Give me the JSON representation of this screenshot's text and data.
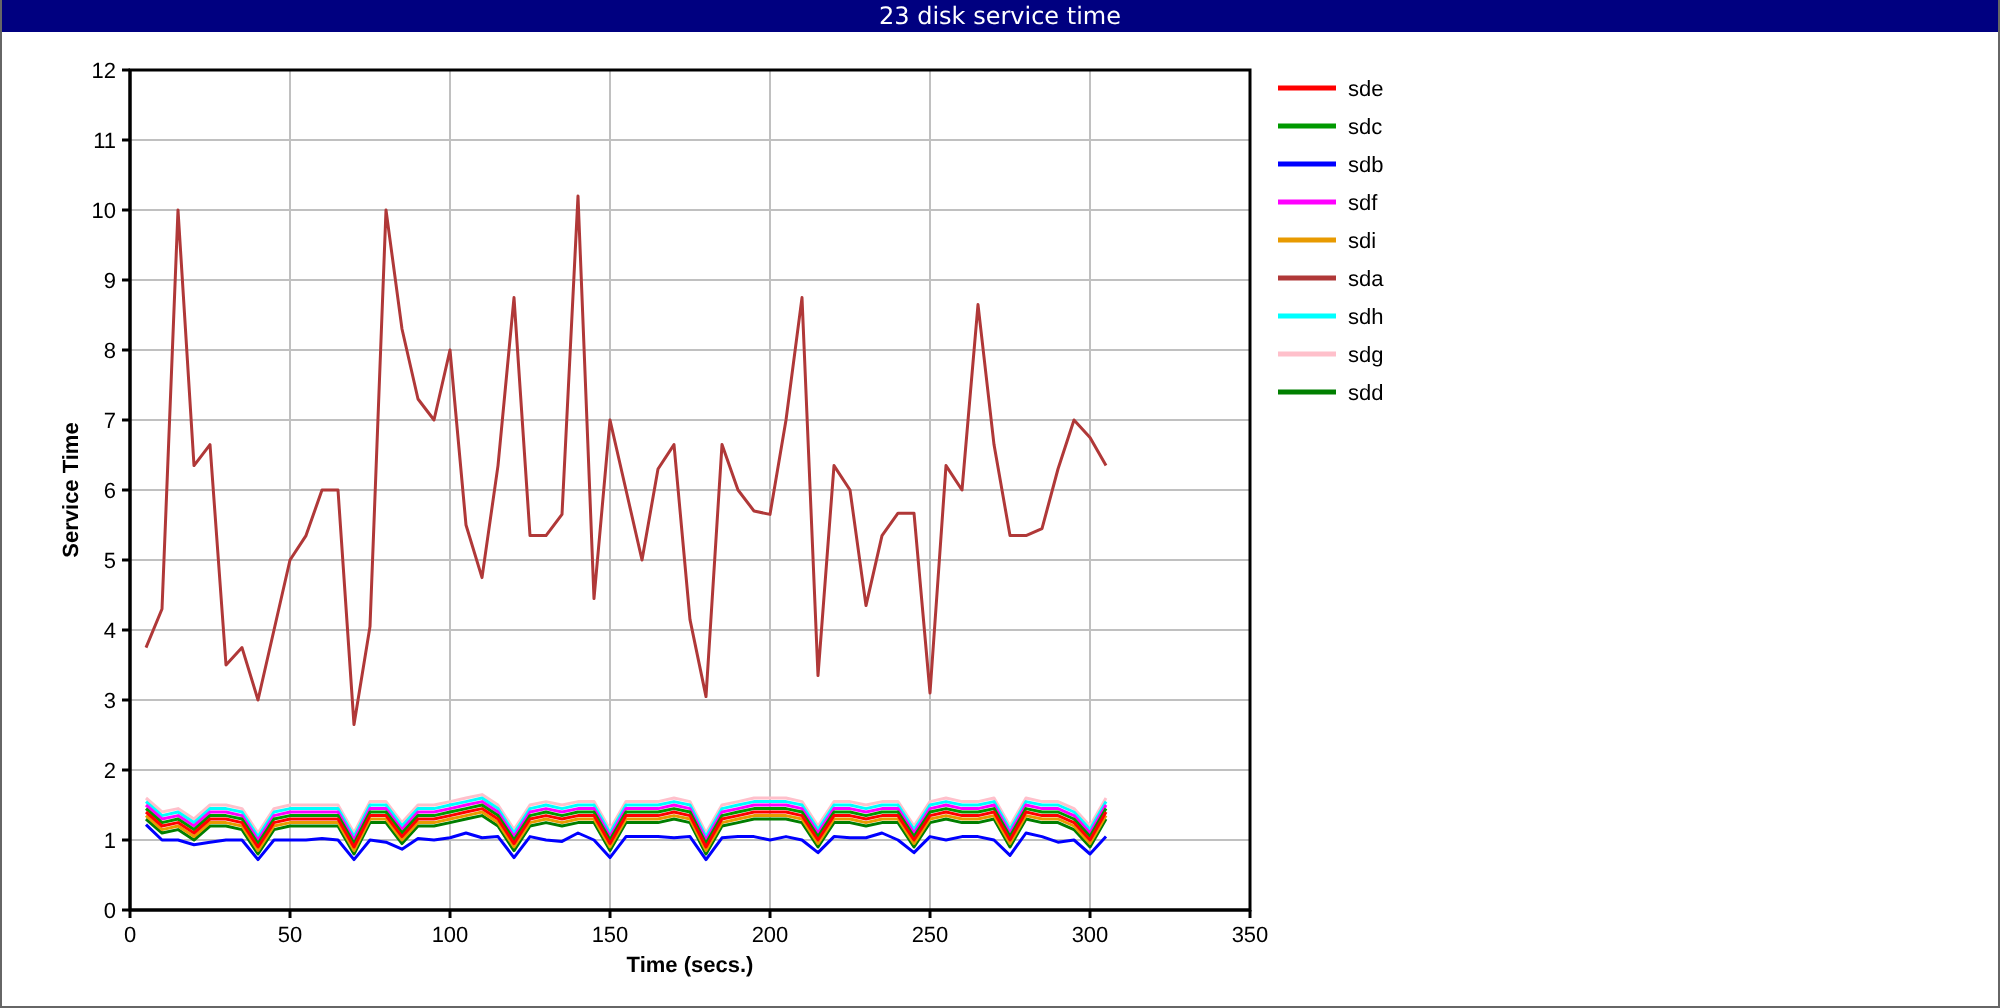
{
  "window": {
    "title": "23 disk service time"
  },
  "chart": {
    "chart_data": {
      "type": "line",
      "xlabel": "Time (secs.)",
      "ylabel": "Service Time",
      "x": [
        5,
        10,
        15,
        20,
        25,
        30,
        35,
        40,
        45,
        50,
        55,
        60,
        65,
        70,
        75,
        80,
        85,
        90,
        95,
        100,
        105,
        110,
        115,
        120,
        125,
        130,
        135,
        140,
        145,
        150,
        155,
        160,
        165,
        170,
        175,
        180,
        185,
        190,
        195,
        200,
        205,
        210,
        215,
        220,
        225,
        230,
        235,
        240,
        245,
        250,
        255,
        260,
        265,
        270,
        275,
        280,
        285,
        290,
        295,
        300,
        305
      ],
      "xlim": [
        0,
        350
      ],
      "ylim": [
        0,
        12
      ],
      "xticks": [
        0,
        50,
        100,
        150,
        200,
        250,
        300,
        350
      ],
      "yticks": [
        0,
        1,
        2,
        3,
        4,
        5,
        6,
        7,
        8,
        9,
        10,
        11,
        12
      ],
      "grid": true,
      "legend": "right",
      "series": [
        {
          "name": "sde",
          "color": "#ff0000",
          "values": [
            1.4,
            1.2,
            1.25,
            1.1,
            1.3,
            1.3,
            1.25,
            0.9,
            1.25,
            1.3,
            1.3,
            1.3,
            1.3,
            0.9,
            1.35,
            1.35,
            1.05,
            1.3,
            1.3,
            1.35,
            1.4,
            1.45,
            1.3,
            0.95,
            1.3,
            1.35,
            1.3,
            1.35,
            1.35,
            0.95,
            1.35,
            1.35,
            1.35,
            1.4,
            1.35,
            0.9,
            1.3,
            1.35,
            1.4,
            1.4,
            1.4,
            1.35,
            1.0,
            1.35,
            1.35,
            1.3,
            1.35,
            1.35,
            1.0,
            1.35,
            1.4,
            1.35,
            1.35,
            1.4,
            1.0,
            1.4,
            1.35,
            1.35,
            1.25,
            1.0,
            1.4
          ]
        },
        {
          "name": "sdc",
          "color": "#009900",
          "values": [
            1.45,
            1.25,
            1.3,
            1.15,
            1.35,
            1.35,
            1.3,
            0.95,
            1.3,
            1.35,
            1.35,
            1.35,
            1.35,
            0.95,
            1.4,
            1.4,
            1.1,
            1.35,
            1.35,
            1.4,
            1.45,
            1.5,
            1.35,
            1.0,
            1.35,
            1.4,
            1.35,
            1.4,
            1.4,
            1.0,
            1.4,
            1.4,
            1.4,
            1.45,
            1.4,
            0.95,
            1.35,
            1.4,
            1.45,
            1.45,
            1.45,
            1.4,
            1.05,
            1.4,
            1.4,
            1.35,
            1.4,
            1.4,
            1.05,
            1.4,
            1.45,
            1.4,
            1.4,
            1.45,
            1.05,
            1.45,
            1.4,
            1.4,
            1.3,
            1.05,
            1.45
          ]
        },
        {
          "name": "sdb",
          "color": "#0000ff",
          "values": [
            1.22,
            1.0,
            1.0,
            0.93,
            0.97,
            1.0,
            1.0,
            0.72,
            1.0,
            1.0,
            1.0,
            1.02,
            1.0,
            0.72,
            1.0,
            0.97,
            0.87,
            1.02,
            1.0,
            1.03,
            1.1,
            1.03,
            1.05,
            0.75,
            1.05,
            1.0,
            0.98,
            1.1,
            1.0,
            0.75,
            1.05,
            1.05,
            1.05,
            1.03,
            1.05,
            0.72,
            1.03,
            1.05,
            1.05,
            1.0,
            1.05,
            1.0,
            0.82,
            1.05,
            1.03,
            1.03,
            1.1,
            1.0,
            0.82,
            1.05,
            1.0,
            1.05,
            1.05,
            1.0,
            0.78,
            1.1,
            1.05,
            0.97,
            1.0,
            0.8,
            1.05
          ]
        },
        {
          "name": "sdf",
          "color": "#ff00ff",
          "values": [
            1.5,
            1.3,
            1.35,
            1.2,
            1.4,
            1.4,
            1.35,
            1.0,
            1.35,
            1.4,
            1.4,
            1.4,
            1.4,
            1.0,
            1.45,
            1.45,
            1.15,
            1.4,
            1.4,
            1.45,
            1.5,
            1.55,
            1.4,
            1.05,
            1.4,
            1.45,
            1.4,
            1.45,
            1.45,
            1.05,
            1.45,
            1.45,
            1.45,
            1.5,
            1.45,
            1.0,
            1.4,
            1.45,
            1.5,
            1.5,
            1.5,
            1.45,
            1.1,
            1.45,
            1.45,
            1.4,
            1.45,
            1.45,
            1.1,
            1.45,
            1.5,
            1.45,
            1.45,
            1.5,
            1.1,
            1.5,
            1.45,
            1.45,
            1.35,
            1.1,
            1.5
          ]
        },
        {
          "name": "sdi",
          "color": "#e89a00",
          "values": [
            1.35,
            1.15,
            1.2,
            1.05,
            1.25,
            1.25,
            1.2,
            0.85,
            1.2,
            1.25,
            1.25,
            1.25,
            1.25,
            0.85,
            1.3,
            1.3,
            1.0,
            1.25,
            1.25,
            1.3,
            1.35,
            1.4,
            1.25,
            0.9,
            1.25,
            1.3,
            1.25,
            1.3,
            1.3,
            0.9,
            1.3,
            1.3,
            1.3,
            1.35,
            1.3,
            0.85,
            1.25,
            1.3,
            1.35,
            1.35,
            1.35,
            1.3,
            0.95,
            1.3,
            1.3,
            1.25,
            1.3,
            1.3,
            0.95,
            1.3,
            1.35,
            1.3,
            1.3,
            1.35,
            0.95,
            1.35,
            1.3,
            1.3,
            1.2,
            0.95,
            1.35
          ]
        },
        {
          "name": "sda",
          "color": "#b03838",
          "values": [
            3.75,
            4.3,
            10,
            6.35,
            6.65,
            3.5,
            3.75,
            3.0,
            4.0,
            5.0,
            5.35,
            6.0,
            6.0,
            2.65,
            4.05,
            10,
            8.3,
            7.3,
            7.0,
            8.0,
            5.5,
            4.75,
            6.35,
            8.75,
            5.35,
            5.35,
            5.65,
            10.2,
            4.45,
            7.0,
            6.0,
            5.0,
            6.3,
            6.65,
            4.15,
            3.05,
            6.65,
            6.0,
            5.7,
            5.65,
            7.0,
            8.75,
            3.35,
            6.35,
            6.0,
            4.35,
            5.35,
            5.67,
            5.67,
            3.1,
            6.35,
            6.0,
            8.65,
            6.65,
            5.35,
            5.35,
            5.45,
            6.3,
            7.0,
            6.75,
            6.35
          ]
        },
        {
          "name": "sdh",
          "color": "#00ffff",
          "values": [
            1.55,
            1.35,
            1.4,
            1.25,
            1.45,
            1.45,
            1.4,
            1.05,
            1.4,
            1.45,
            1.45,
            1.45,
            1.45,
            1.05,
            1.5,
            1.5,
            1.2,
            1.45,
            1.45,
            1.5,
            1.55,
            1.6,
            1.45,
            1.1,
            1.45,
            1.5,
            1.45,
            1.5,
            1.5,
            1.1,
            1.5,
            1.5,
            1.5,
            1.55,
            1.5,
            1.05,
            1.45,
            1.5,
            1.55,
            1.55,
            1.55,
            1.5,
            1.15,
            1.5,
            1.5,
            1.45,
            1.5,
            1.5,
            1.15,
            1.5,
            1.55,
            1.5,
            1.5,
            1.55,
            1.15,
            1.55,
            1.5,
            1.5,
            1.4,
            1.15,
            1.55
          ]
        },
        {
          "name": "sdg",
          "color": "#ffc0cb",
          "values": [
            1.6,
            1.4,
            1.45,
            1.3,
            1.5,
            1.5,
            1.45,
            1.1,
            1.45,
            1.5,
            1.5,
            1.5,
            1.5,
            1.1,
            1.55,
            1.55,
            1.25,
            1.5,
            1.5,
            1.55,
            1.6,
            1.65,
            1.5,
            1.15,
            1.5,
            1.55,
            1.5,
            1.55,
            1.55,
            1.15,
            1.55,
            1.55,
            1.55,
            1.6,
            1.55,
            1.1,
            1.5,
            1.55,
            1.6,
            1.6,
            1.6,
            1.55,
            1.2,
            1.55,
            1.55,
            1.5,
            1.55,
            1.55,
            1.2,
            1.55,
            1.6,
            1.55,
            1.55,
            1.6,
            1.2,
            1.6,
            1.55,
            1.55,
            1.45,
            1.2,
            1.6
          ]
        },
        {
          "name": "sdd",
          "color": "#007f00",
          "values": [
            1.3,
            1.1,
            1.15,
            1.0,
            1.2,
            1.2,
            1.15,
            0.8,
            1.15,
            1.2,
            1.2,
            1.2,
            1.2,
            0.8,
            1.25,
            1.25,
            0.95,
            1.2,
            1.2,
            1.25,
            1.3,
            1.35,
            1.2,
            0.85,
            1.2,
            1.25,
            1.2,
            1.25,
            1.25,
            0.85,
            1.25,
            1.25,
            1.25,
            1.3,
            1.25,
            0.8,
            1.2,
            1.25,
            1.3,
            1.3,
            1.3,
            1.25,
            0.9,
            1.25,
            1.25,
            1.2,
            1.25,
            1.25,
            0.9,
            1.25,
            1.3,
            1.25,
            1.25,
            1.3,
            0.9,
            1.3,
            1.25,
            1.25,
            1.15,
            0.9,
            1.3
          ]
        }
      ]
    }
  }
}
